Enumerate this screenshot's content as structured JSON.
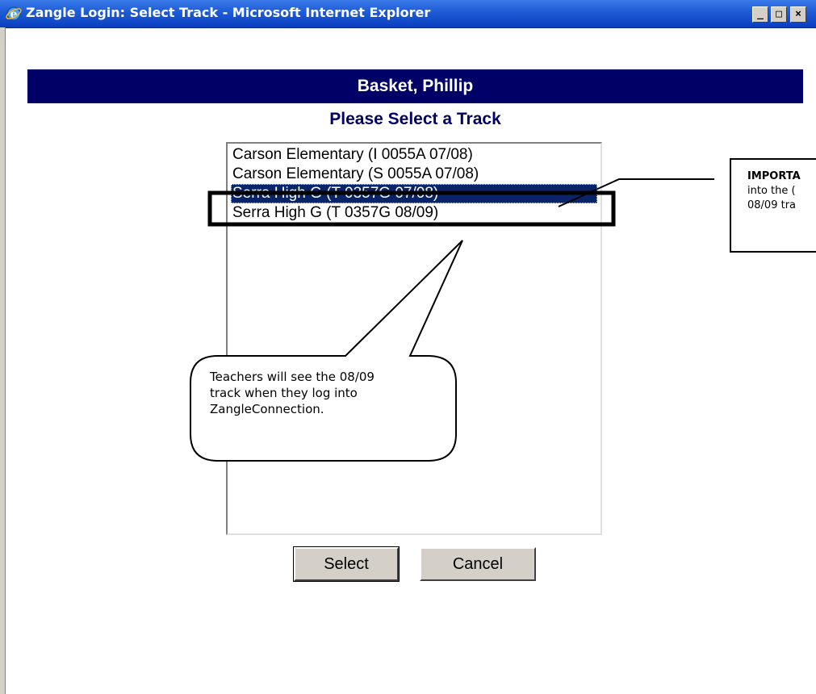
{
  "window": {
    "title": "Zangle Login: Select Track - Microsoft Internet Explorer",
    "minimize_label": "_",
    "maximize_label": "□",
    "close_label": "×"
  },
  "page": {
    "heading": "Basket, Phillip",
    "subheading": "Please Select a Track"
  },
  "track_list": {
    "items": [
      "Carson Elementary (I 0055A 07/08)",
      "Carson Elementary (S 0055A 07/08)",
      "Serra High G (T 0357G 07/08)",
      "Serra High G (T 0357G 08/09)"
    ],
    "selected_index": 2
  },
  "buttons": {
    "select": "Select",
    "cancel": "Cancel"
  },
  "annotations": {
    "callout": "Teachers will see the 08/09\ntrack when they log into\nZangleConnection.",
    "note_line1": "IMPORTA",
    "note_line2": "into the (",
    "note_line3": "08/09 tra"
  },
  "colors": {
    "banner": "#000066",
    "selection": "#0a246a",
    "titlebar": "#0a3fbf"
  }
}
